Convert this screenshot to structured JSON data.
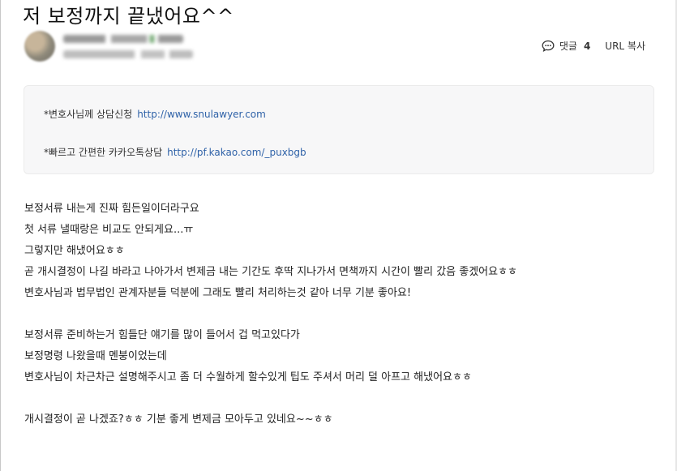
{
  "post": {
    "title": "저 보정까지 끝냈어요^^",
    "comment_label": "댓글",
    "comment_count": "4",
    "url_copy_label": "URL 복사"
  },
  "consult_box": {
    "lines": [
      {
        "prefix": "*변호사님께 상담신청",
        "link": "http://www.snulawyer.com"
      },
      {
        "prefix": "*빠르고 간편한 카카오톡상담",
        "link": "http://pf.kakao.com/_puxbgb"
      }
    ]
  },
  "body": {
    "paragraph1": [
      "보정서류 내는게 진짜 힘든일이더라구요",
      "첫 서류 낼때랑은 비교도 안되게요...ㅠ",
      "그렇지만 해냈어요ㅎㅎ",
      "곧 개시결정이 나길 바라고 나아가서 변제금 내는 기간도 후딱 지나가서 면책까지 시간이 빨리 갔음 좋겠어요ㅎㅎ",
      "변호사님과 법무법인 관계자분들 덕분에 그래도 빨리 처리하는것 같아 너무 기분 좋아요!"
    ],
    "paragraph2": [
      "보정서류 준비하는거 힘들단 얘기를 많이 들어서 겁 먹고있다가",
      "보정명령 나왔을때 멘붕이었는데",
      "변호사님이 차근차근 설명해주시고 좀 더 수월하게 할수있게 팁도 주셔서 머리 덜 아프고 해냈어요ㅎㅎ"
    ],
    "paragraph3": [
      "개시결정이 곧 나겠죠?ㅎㅎ 기분 좋게 변제금 모아두고 있네요~~ㅎㅎ"
    ]
  }
}
